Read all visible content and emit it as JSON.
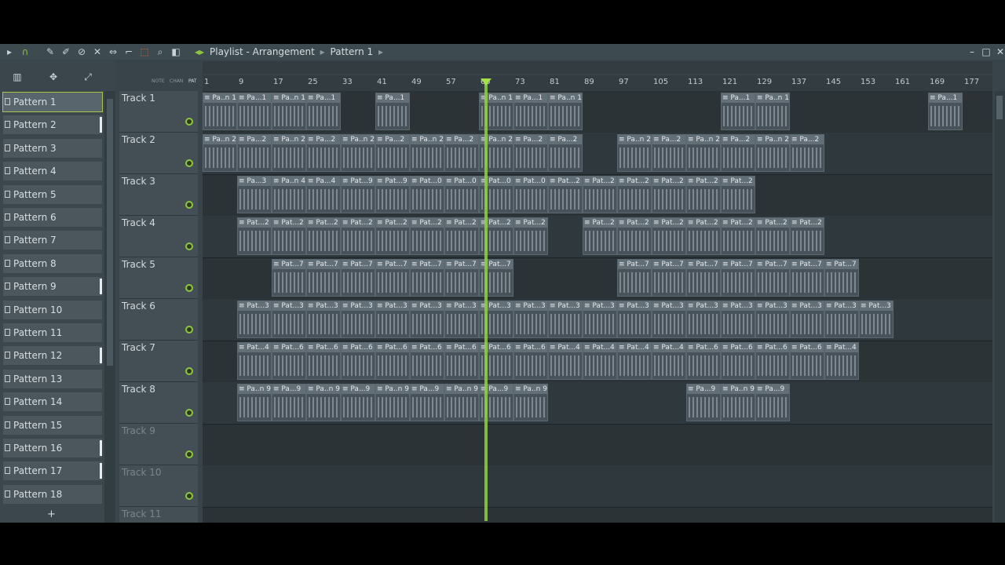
{
  "window": {
    "title_parts": [
      "Playlist - Arrangement",
      "Pattern 1"
    ],
    "controls": {
      "minimize": "–",
      "maximize": "□",
      "close": "✕"
    }
  },
  "toolbar_icons": [
    "arrow-icon",
    "magnet-icon",
    "pencil-icon",
    "paint-icon",
    "delete-icon",
    "mute-icon",
    "slip-icon",
    "slice-icon",
    "select-icon",
    "zoom-icon",
    "playback-icon"
  ],
  "left_tools": [
    "pattern-picker-icon",
    "play-tool-icon",
    "link-icon"
  ],
  "ruler": {
    "bars": [
      "1",
      "9",
      "17",
      "25",
      "33",
      "41",
      "49",
      "57",
      "65",
      "73",
      "81",
      "89",
      "97",
      "105",
      "113",
      "121",
      "129",
      "137",
      "145",
      "153",
      "161",
      "169",
      "177"
    ],
    "labels": {
      "note": "NOTE",
      "chan": "CHAN",
      "pat": "PAT"
    }
  },
  "patterns": [
    "Pattern 1",
    "Pattern 2",
    "Pattern 3",
    "Pattern 4",
    "Pattern 5",
    "Pattern 6",
    "Pattern 7",
    "Pattern 8",
    "Pattern 9",
    "Pattern 10",
    "Pattern 11",
    "Pattern 12",
    "Pattern 13",
    "Pattern 14",
    "Pattern 15",
    "Pattern 16",
    "Pattern 17",
    "Pattern 18"
  ],
  "add_pattern": "+",
  "tracks": [
    {
      "name": "Track 1",
      "clips": [
        "Pa..n 1",
        "Pa...1",
        "Pa..n 1",
        "Pa...1",
        "Pa...1",
        "Pa..n 1",
        "Pa...1",
        "Pa..n 1",
        "Pa...1",
        "Pa..n 1",
        "Pa...1"
      ]
    },
    {
      "name": "Track 2",
      "clips": [
        "Pa..n 2",
        "Pa...2",
        "Pa..n 2",
        "Pa...2",
        "Pa..n 2",
        "Pa...2",
        "Pa..n 2",
        "Pa...2",
        "Pa..n 2",
        "Pa...2",
        "Pa...2",
        "Pa..n 2",
        "Pa...2",
        "Pa..n 2",
        "Pa...2",
        "Pa..n 2",
        "Pa...2"
      ]
    },
    {
      "name": "Track 3",
      "clips": [
        "Pa...3",
        "Pa..n 4",
        "Pa...4",
        "Pat...9",
        "Pat...9",
        "Pat...0",
        "Pat...0",
        "Pat...0",
        "Pat...0",
        "Pat...2",
        "Pat...2",
        "Pat...2",
        "Pat...2",
        "Pat...2",
        "Pat...2"
      ]
    },
    {
      "name": "Track 4",
      "clips": [
        "Pat...2",
        "Pat...2",
        "Pat...2",
        "Pat...2",
        "Pat...2",
        "Pat...2",
        "Pat...2",
        "Pat...2",
        "Pat...2",
        "Pat...2",
        "Pat...2",
        "Pat...2",
        "Pat...2",
        "Pat...2",
        "Pat...2",
        "Pat...2"
      ]
    },
    {
      "name": "Track 5",
      "clips": [
        "Pat...7",
        "Pat...7",
        "Pat...7",
        "Pat...7",
        "Pat...7",
        "Pat...7",
        "Pat...7",
        "Pat...7",
        "Pat...7",
        "Pat...7",
        "Pat...7",
        "Pat...7",
        "Pat...7",
        "Pat...7"
      ]
    },
    {
      "name": "Track 6",
      "clips": [
        "Pat...3",
        "Pat...3",
        "Pat...3",
        "Pat...3",
        "Pat...3",
        "Pat...3",
        "Pat...3",
        "Pat...3",
        "Pat...3",
        "Pat...3",
        "Pat...3",
        "Pat...3",
        "Pat...3",
        "Pat...3",
        "Pat...3",
        "Pat...3",
        "Pat...3",
        "Pat...3",
        "Pat...3"
      ]
    },
    {
      "name": "Track 7",
      "clips": [
        "Pat...4",
        "Pat...6",
        "Pat...6",
        "Pat...6",
        "Pat...6",
        "Pat...6",
        "Pat...6",
        "Pat...6",
        "Pat...6",
        "Pat...4",
        "Pat...4",
        "Pat...4",
        "Pat...4",
        "Pat...6",
        "Pat...6",
        "Pat...6",
        "Pat...6",
        "Pat...4"
      ]
    },
    {
      "name": "Track 8",
      "clips": [
        "Pa..n 9",
        "Pa...9",
        "Pa..n 9",
        "Pa...9",
        "Pa..n 9",
        "Pa...9",
        "Pa..n 9",
        "Pa...9",
        "Pa..n 9",
        "Pa...9",
        "Pa..n 9",
        "Pa...9"
      ]
    },
    {
      "name": "Track 9",
      "clips": []
    },
    {
      "name": "Track 10",
      "clips": []
    },
    {
      "name": "Track 11",
      "clips": []
    }
  ]
}
